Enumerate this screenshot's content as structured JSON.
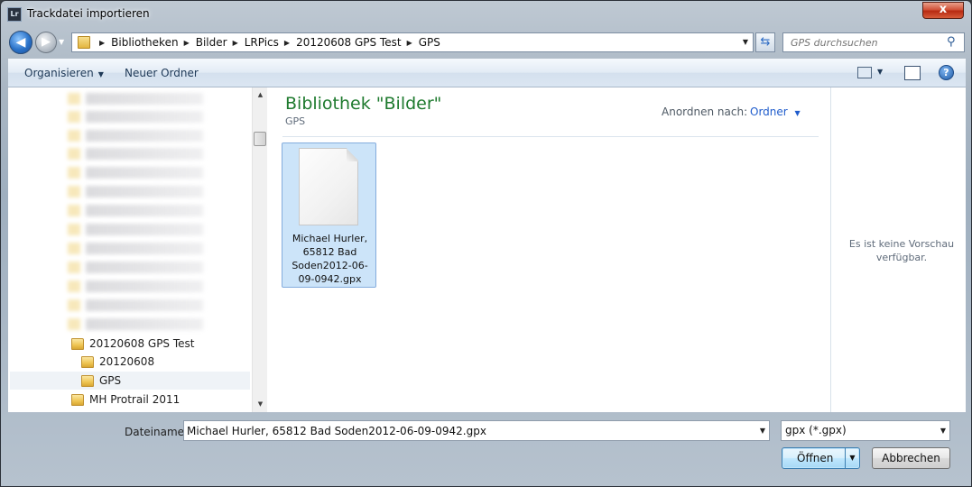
{
  "window": {
    "title": "Trackdatei importieren",
    "app_icon_text": "Lr",
    "close_label": "x"
  },
  "nav": {
    "back_glyph": "◀",
    "forward_glyph": "▶",
    "breadcrumbs": [
      "Bibliotheken",
      "Bilder",
      "LRPics",
      "20120608 GPS Test",
      "GPS"
    ],
    "search_placeholder": "GPS durchsuchen"
  },
  "toolbar": {
    "organize_label": "Organisieren",
    "new_folder_label": "Neuer Ordner",
    "help_label": "?"
  },
  "tree": {
    "items": [
      {
        "label": "20120608 GPS Test",
        "selected": false
      },
      {
        "label": "20120608",
        "selected": false
      },
      {
        "label": "GPS",
        "selected": true
      },
      {
        "label": "MH Protrail 2011",
        "selected": false
      }
    ]
  },
  "main": {
    "library_title": "Bibliothek \"Bilder\"",
    "library_subtitle": "GPS",
    "arrange_label": "Anordnen nach:",
    "arrange_value": "Ordner",
    "file_name": "Michael Hurler, 65812 Bad Soden2012-06-09-0942.gpx"
  },
  "preview": {
    "empty_text": "Es ist keine Vorschau verfügbar."
  },
  "bottom": {
    "filename_label": "Dateiname:",
    "filename_value": "Michael Hurler, 65812 Bad Soden2012-06-09-0942.gpx",
    "filter_value": "gpx (*.gpx)",
    "open_label": "Öffnen",
    "cancel_label": "Abbrechen"
  },
  "colors": {
    "accent_green": "#1e7a2e",
    "link_blue": "#1f5ccc",
    "selection": "#cce4f9"
  }
}
